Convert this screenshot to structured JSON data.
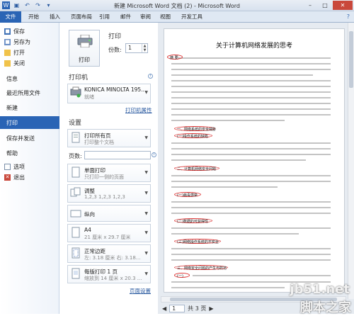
{
  "titlebar": {
    "title": "新建 Microsoft Word 文档 (2) - Microsoft Word",
    "minimize": "–",
    "maximize": "□",
    "close": "✕"
  },
  "ribbon": {
    "tabs": [
      "文件",
      "开始",
      "插入",
      "页面布局",
      "引用",
      "邮件",
      "审阅",
      "视图",
      "开发工具"
    ],
    "help": "?"
  },
  "nav": {
    "save": "保存",
    "save_as": "另存为",
    "open": "打开",
    "close": "关闭",
    "info": "信息",
    "recent": "最近所用文件",
    "new": "新建",
    "print": "打印",
    "save_send": "保存并发送",
    "help": "帮助",
    "options": "选项",
    "exit": "退出"
  },
  "print": {
    "heading": "打印",
    "button_label": "打印",
    "copies_label": "份数:",
    "copies_value": "1",
    "printer_heading": "打印机",
    "printer_name": "KONICA MINOLTA 195...",
    "printer_status": "就绪",
    "printer_properties": "打印机属性",
    "settings_heading": "设置",
    "pages_label": "页数:",
    "page_setup": "页面设置",
    "settings": [
      {
        "t1": "打印所有页",
        "t2": "打印整个文档"
      },
      {
        "t1": "单面打印",
        "t2": "只打印一侧的页面"
      },
      {
        "t1": "调整",
        "t2": "1,2,3    1,2,3    1,2,3"
      },
      {
        "t1": "纵向",
        "t2": ""
      },
      {
        "t1": "A4",
        "t2": "21 厘米 x 29.7 厘米"
      },
      {
        "t1": "正常边距",
        "t2": "左: 3.18 厘米   右: 3.18..."
      },
      {
        "t1": "每版打印 1 页",
        "t2": "缩放到 14 厘米 x 20.3 ..."
      }
    ]
  },
  "preview": {
    "doc_title": "关于计算机网络发展的思考",
    "marks": [
      "摘 要:",
      "一、网络系统的安全威胁",
      "(一)操作系统的缺陷",
      "二、计算机网络安全问题",
      "(一)病毒感染",
      "(二)数据的可获得性",
      "(三)网络操作系统的不安全",
      "三、网络安全问题的产生与防范",
      "(一)"
    ],
    "page_current": "1",
    "page_total": "共 3 页"
  },
  "watermark": {
    "site": "jb51.net",
    "name": "脚本之家"
  }
}
